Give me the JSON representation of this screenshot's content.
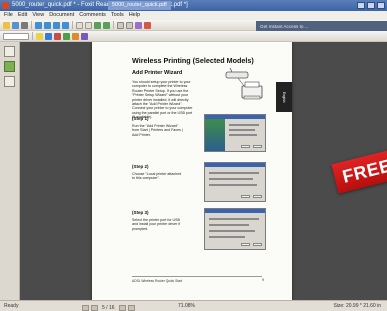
{
  "window": {
    "title": "5000_router_quick.pdf * - Foxit Reader - [5000_router_quick.pdf *]",
    "second_tab": "5000_router_quick.pdf"
  },
  "menu": [
    "File",
    "Edit",
    "View",
    "Document",
    "Comments",
    "Tools",
    "Help"
  ],
  "right_banner": "Get Instant Access to ...",
  "document": {
    "title": "Wireless Printing (Selected Models)",
    "wizard_heading": "Add Printer Wizard",
    "intro_text": "You should setup your printer to your computer to complete the Wireless Router Printer Setup. If you use the \"Printer Setup Wizard\" without your printer driver installed, it will directly attach the \"Add Printer Wizard\". Connect your printer to your computer using the parallel port or the USB port (if available).",
    "side_tab": "English",
    "steps": [
      {
        "label": "(Step 1)",
        "text": "Run the \"Add Printer Wizard\" from Start | Printers and Faxes | Add Printer."
      },
      {
        "label": "(Step 2)",
        "text": "Choose \"Local printer attached to this computer\"."
      },
      {
        "label": "(Step 3)",
        "text": "Select the printer port for USB and install your printer driver if prompted."
      }
    ],
    "footer": "ADSL Wireless Router Quick Start",
    "page_number": "9"
  },
  "badge": "FREE",
  "status": {
    "ready": "Ready",
    "page": "5 / 16",
    "zoom": "71.08%",
    "size": "Size: 20.99 * 21.60 in"
  },
  "colors": {
    "titlebar": "#3c64a6",
    "doc_background": "#4b4b4b",
    "badge": "#d01818"
  }
}
